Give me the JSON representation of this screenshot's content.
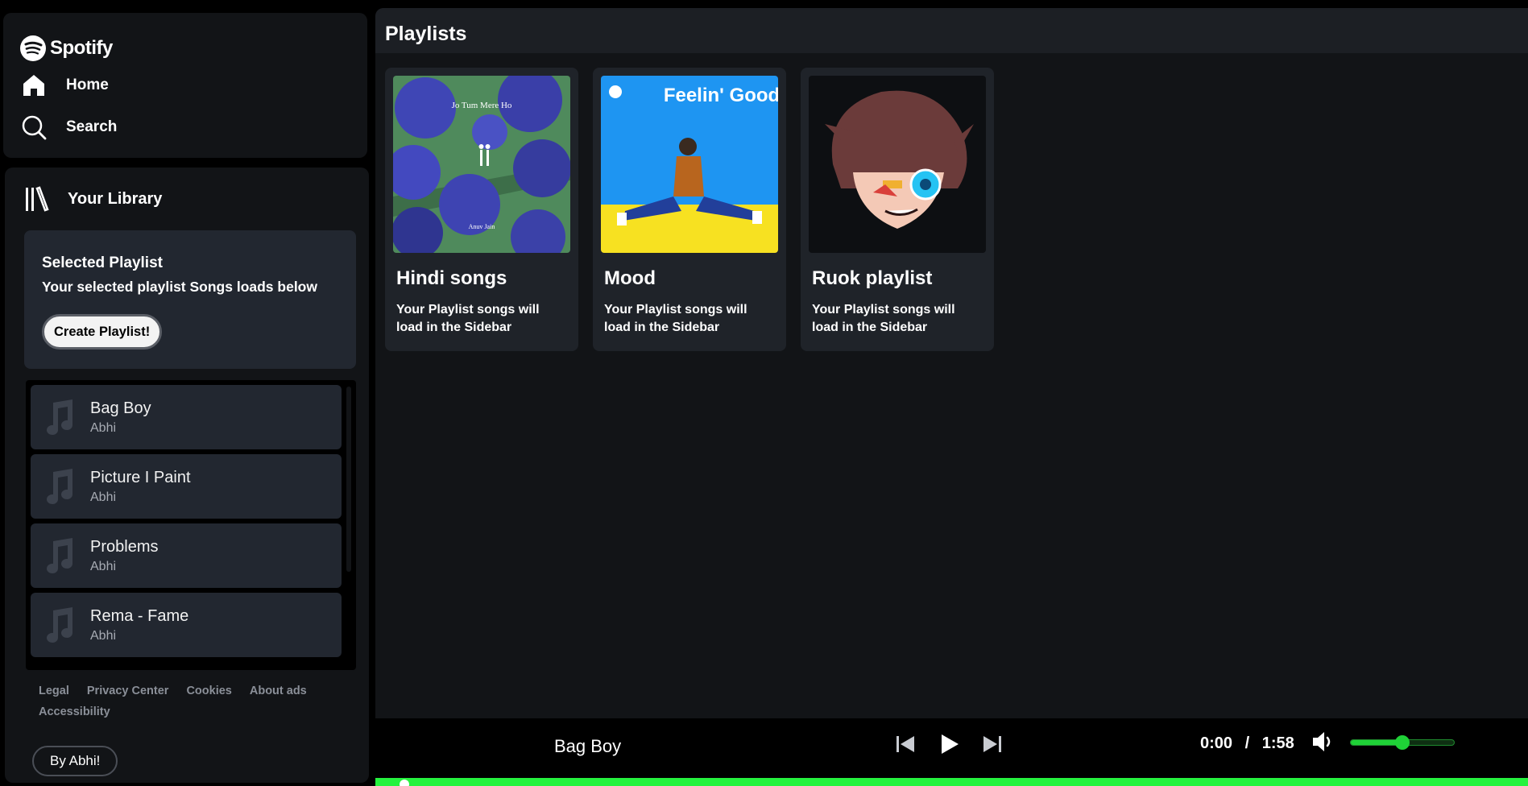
{
  "brand": {
    "name": "Spotify"
  },
  "nav": {
    "home_label": "Home",
    "search_label": "Search"
  },
  "library": {
    "title": "Your Library",
    "selected": {
      "title": "Selected Playlist",
      "subtitle": "Your selected playlist Songs loads below",
      "create_label": "Create Playlist!"
    },
    "songs": [
      {
        "name": "Bag Boy",
        "artist": "Abhi"
      },
      {
        "name": "Picture I Paint",
        "artist": "Abhi"
      },
      {
        "name": "Problems",
        "artist": "Abhi"
      },
      {
        "name": "Rema - Fame",
        "artist": "Abhi"
      }
    ],
    "footer_links": [
      "Legal",
      "Privacy Center",
      "Cookies",
      "About ads",
      "Accessibility"
    ],
    "author_button": "By Abhi!"
  },
  "main": {
    "title": "Playlists",
    "playlists": [
      {
        "title": "Hindi songs",
        "description": "Your Playlist songs will load in the Sidebar",
        "cover_text_top": "Jo Tum Mere Ho",
        "cover_text_bottom": "Anuv Jain"
      },
      {
        "title": "Mood",
        "description": "Your Playlist songs will load in the Sidebar",
        "cover_text_top": "Feelin' Good"
      },
      {
        "title": "Ruok playlist",
        "description": "Your Playlist songs will load in the Sidebar"
      }
    ]
  },
  "player": {
    "now_playing": "Bag Boy",
    "current_time": "0:00",
    "separator": "/",
    "duration": "1:58",
    "volume_percent": 50
  },
  "colors": {
    "accent": "#1fd137",
    "panel": "#121417",
    "card": "#1f2329"
  },
  "icons": {
    "logo": "spotify-logo-icon",
    "home": "home-icon",
    "search": "search-icon",
    "library": "library-icon",
    "song": "music-note-icon",
    "prev": "skip-previous-icon",
    "play": "play-icon",
    "next": "skip-next-icon",
    "volume": "volume-icon"
  }
}
